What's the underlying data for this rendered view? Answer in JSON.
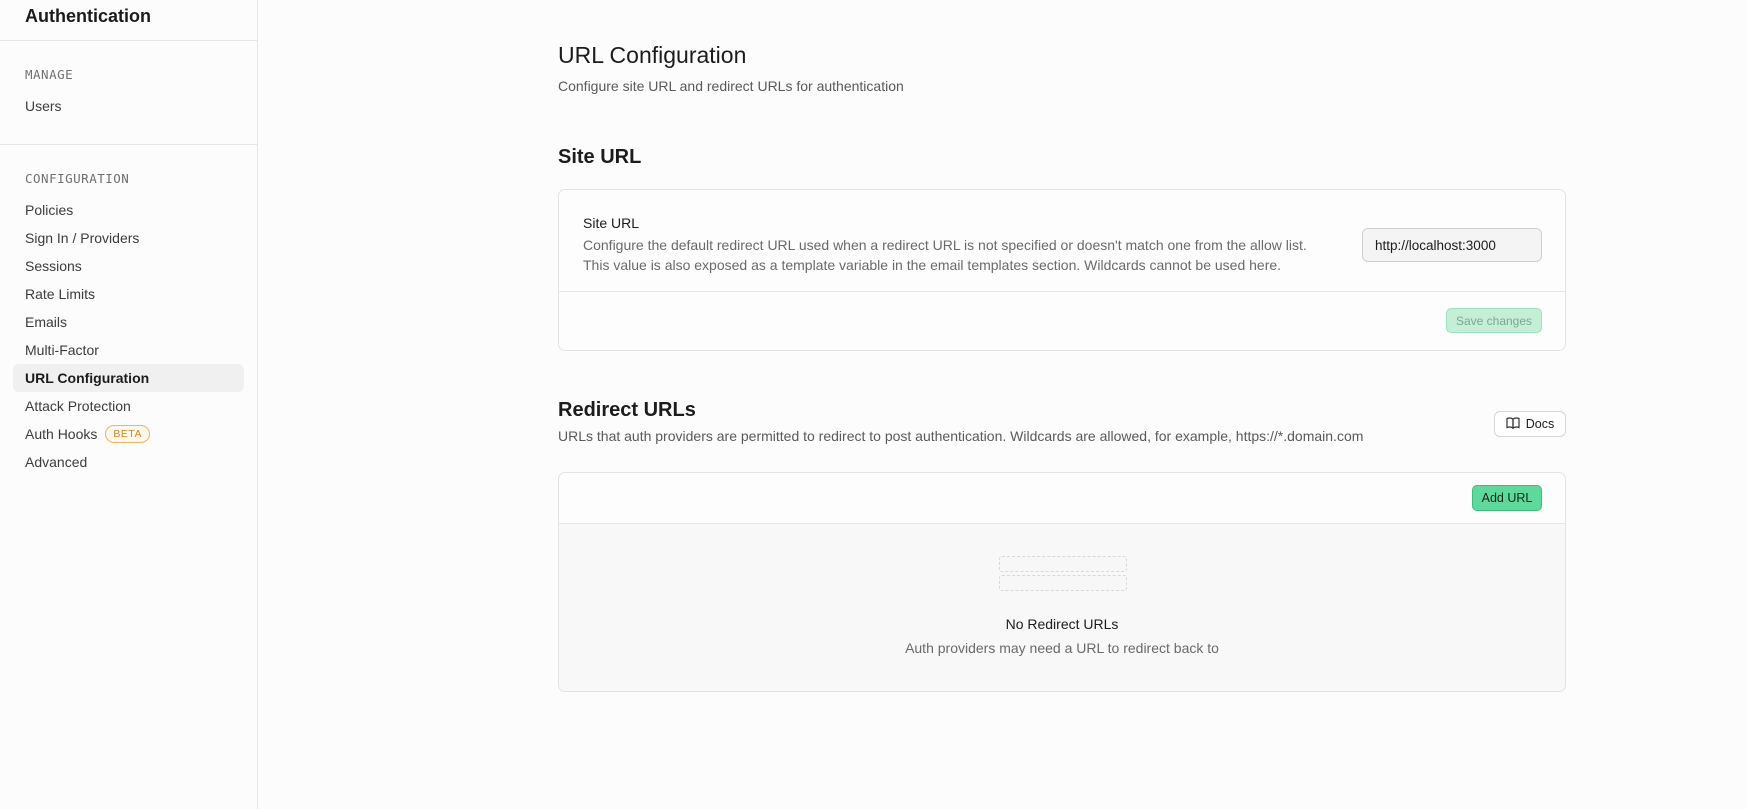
{
  "sidebar": {
    "title": "Authentication",
    "manage_label": "MANAGE",
    "manage_items": [
      {
        "label": "Users"
      }
    ],
    "config_label": "CONFIGURATION",
    "config_items": [
      {
        "label": "Policies"
      },
      {
        "label": "Sign In / Providers"
      },
      {
        "label": "Sessions"
      },
      {
        "label": "Rate Limits"
      },
      {
        "label": "Emails"
      },
      {
        "label": "Multi-Factor"
      },
      {
        "label": "URL Configuration",
        "active": true
      },
      {
        "label": "Attack Protection"
      },
      {
        "label": "Auth Hooks",
        "badge": "BETA"
      },
      {
        "label": "Advanced"
      }
    ]
  },
  "page": {
    "title": "URL Configuration",
    "subtitle": "Configure site URL and redirect URLs for authentication"
  },
  "site_url": {
    "section_title": "Site URL",
    "field_title": "Site URL",
    "description_line1": "Configure the default redirect URL used when a redirect URL is not specified or doesn't match one from the allow list.",
    "description_line2": "This value is also exposed as a template variable in the email templates section. Wildcards cannot be used here.",
    "value": "http://localhost:3000",
    "save_label": "Save changes"
  },
  "redirect_urls": {
    "section_title": "Redirect URLs",
    "description": "URLs that auth providers are permitted to redirect to post authentication. Wildcards are allowed, for example, https://*.domain.com",
    "docs_label": "Docs",
    "docs_icon": "book-open-icon",
    "add_label": "Add URL",
    "empty_title": "No Redirect URLs",
    "empty_desc": "Auth providers may need a URL to redirect back to"
  },
  "colors": {
    "brand_green": "#5fd89c",
    "badge_orange": "#f3b35b"
  }
}
